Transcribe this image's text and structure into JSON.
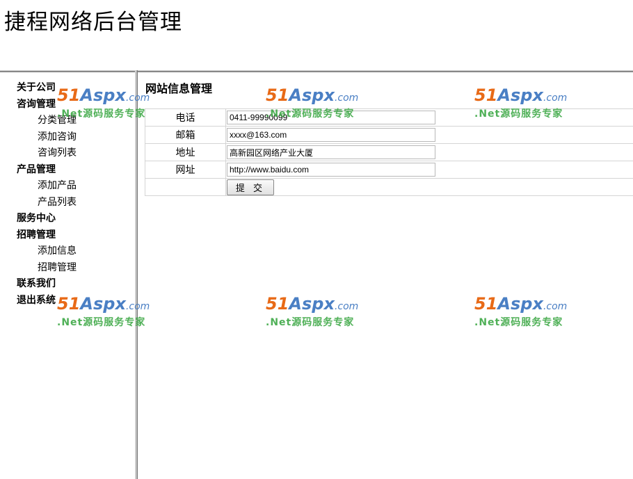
{
  "header": {
    "title": "捷程网络后台管理"
  },
  "sidebar": {
    "items": [
      {
        "label": "关于公司",
        "level": "top"
      },
      {
        "label": "咨询管理",
        "level": "top"
      },
      {
        "label": "分类管理",
        "level": "sub"
      },
      {
        "label": "添加咨询",
        "level": "sub"
      },
      {
        "label": "咨询列表",
        "level": "sub"
      },
      {
        "label": "产品管理",
        "level": "top"
      },
      {
        "label": "添加产品",
        "level": "sub"
      },
      {
        "label": "产品列表",
        "level": "sub"
      },
      {
        "label": "服务中心",
        "level": "top"
      },
      {
        "label": "招聘管理",
        "level": "top"
      },
      {
        "label": "添加信息",
        "level": "sub"
      },
      {
        "label": "招聘管理",
        "level": "sub"
      },
      {
        "label": "联系我们",
        "level": "top"
      },
      {
        "label": "退出系统",
        "level": "top"
      }
    ]
  },
  "main": {
    "title": "网站信息管理",
    "form": {
      "phone": {
        "label": "电话",
        "value": "0411-99990099"
      },
      "email": {
        "label": "邮箱",
        "value": "xxxx@163.com"
      },
      "address": {
        "label": "地址",
        "value": "高新园区网络产业大厦"
      },
      "website": {
        "label": "网址",
        "value": "http://www.baidu.com"
      },
      "submit_label": "提 交"
    }
  },
  "watermark": {
    "logo_num": "51",
    "logo_word": "Aspx",
    "logo_suffix": ".com",
    "tagline": ".Net源码服务专家",
    "colors": {
      "num": "#e86a17",
      "word": "#4a7fc4",
      "tagline": "#3da845"
    }
  }
}
